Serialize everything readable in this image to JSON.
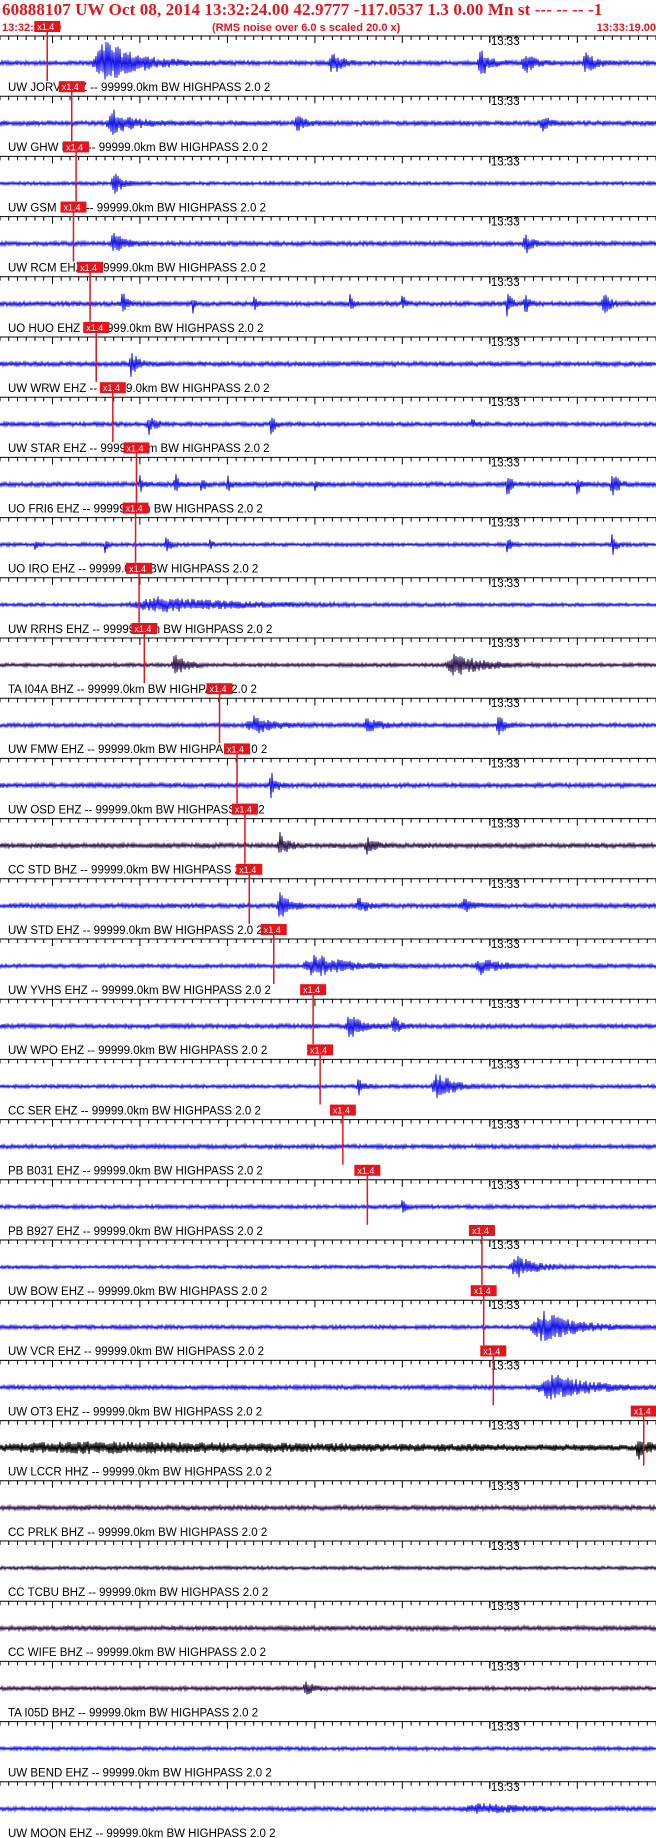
{
  "header": {
    "title": "60888107 UW Oct 08, 2014 13:32:24.00   42.9777 -117.0537  1.3 0.00 Mn st --- -- --  -1",
    "start_time": "13:32:04.00",
    "note": "(RMS noise over 6.0 s scaled 20.0 x)",
    "end_time": "13:33:19.00"
  },
  "colors": {
    "header_text": "#e8141c",
    "trace_blue": "#1414e6",
    "trace_dark": "#2a1450",
    "trace_black": "#000000",
    "pick": "#e8141c"
  },
  "chart_data": {
    "type": "seismogram",
    "x_start": "13:32:04.00",
    "x_end": "13:33:19.00",
    "minute_label": "13:33",
    "pick_label": "x1.4",
    "traces": [
      {
        "label": "UW JORV EHZ -- 99999.0km BW  HIGHPASS  2.0  2",
        "color": "blue",
        "pick": "13:32:09.40",
        "bursts": [
          {
            "t": 12,
            "w": 5,
            "a": 1.6
          },
          {
            "t": 38,
            "w": 1.5,
            "a": 0.8
          },
          {
            "t": 55,
            "w": 1.5,
            "a": 1.0
          },
          {
            "t": 60,
            "w": 1.5,
            "a": 0.8
          },
          {
            "t": 67,
            "w": 1.5,
            "a": 0.7
          }
        ]
      },
      {
        "label": "UW GHW EHZ -- 99999.0km BW  HIGHPASS  2.0  2",
        "color": "blue",
        "pick": "13:32:12.20",
        "bursts": [
          {
            "t": 13,
            "w": 3,
            "a": 0.9
          },
          {
            "t": 34,
            "w": 1.2,
            "a": 0.6
          },
          {
            "t": 62,
            "w": 1.2,
            "a": 0.5
          }
        ]
      },
      {
        "label": "UW GSM EHZ -- 99999.0km BW  HIGHPASS  2.0  2",
        "color": "blue",
        "pick": "13:32:12.70",
        "bursts": [
          {
            "t": 13,
            "w": 1.2,
            "a": 0.9
          }
        ]
      },
      {
        "label": "UW RCM EHZ -- 99999.0km BW  HIGHPASS  2.0  2",
        "color": "blue",
        "pick": "13:32:12.40",
        "bursts": [
          {
            "t": 13,
            "w": 1.5,
            "a": 0.8
          },
          {
            "t": 60,
            "w": 1.0,
            "a": 0.8
          }
        ]
      },
      {
        "label": "UO HUO EHZ -- 99999.0km BW  HIGHPASS  2.0  2",
        "color": "blue",
        "pick": "13:32:14.30",
        "bursts": [
          {
            "t": 14,
            "w": 0.6,
            "a": 0.9
          },
          {
            "t": 22,
            "w": 0.4,
            "a": 0.7
          },
          {
            "t": 29,
            "w": 0.4,
            "a": 0.6
          },
          {
            "t": 40,
            "w": 0.4,
            "a": 0.7
          },
          {
            "t": 46,
            "w": 0.4,
            "a": 0.7
          },
          {
            "t": 58,
            "w": 0.6,
            "a": 1.0
          },
          {
            "t": 60,
            "w": 0.6,
            "a": 0.9
          },
          {
            "t": 69,
            "w": 0.8,
            "a": 1.2
          }
        ]
      },
      {
        "label": "UW WRW EHZ -- 99999.0km BW  HIGHPASS  2.0  2",
        "color": "blue",
        "pick": "13:32:15.00",
        "bursts": [
          {
            "t": 15,
            "w": 1.2,
            "a": 0.8
          }
        ]
      },
      {
        "label": "UW STAR EHZ -- 99999.0km BW  HIGHPASS  2.0  2",
        "color": "blue",
        "pick": "13:32:16.90",
        "bursts": [
          {
            "t": 17,
            "w": 1.0,
            "a": 0.7
          },
          {
            "t": 31,
            "w": 0.6,
            "a": 0.8
          },
          {
            "t": 54,
            "w": 0.5,
            "a": 0.4
          }
        ]
      },
      {
        "label": "UO FRI6 EHZ -- 99999.0km BW  HIGHPASS  2.0  2",
        "color": "blue",
        "pick": "13:32:19.60",
        "bursts": [
          {
            "t": 16,
            "w": 0.5,
            "a": 0.6
          },
          {
            "t": 20,
            "w": 0.6,
            "a": 0.8
          },
          {
            "t": 23,
            "w": 0.5,
            "a": 0.7
          },
          {
            "t": 26,
            "w": 0.5,
            "a": 0.6
          },
          {
            "t": 36,
            "w": 0.4,
            "a": 0.5
          },
          {
            "t": 58,
            "w": 0.6,
            "a": 0.9
          },
          {
            "t": 66,
            "w": 0.5,
            "a": 0.8
          },
          {
            "t": 70,
            "w": 0.8,
            "a": 1.1
          }
        ]
      },
      {
        "label": "UO IRO EHZ -- 99999.0km BW  HIGHPASS  2.0  2",
        "color": "blue",
        "pick": "13:32:19.50",
        "bursts": [
          {
            "t": 4,
            "w": 0.4,
            "a": 0.6
          },
          {
            "t": 12,
            "w": 0.4,
            "a": 0.5
          },
          {
            "t": 19,
            "w": 0.6,
            "a": 0.7
          },
          {
            "t": 24,
            "w": 0.4,
            "a": 0.5
          },
          {
            "t": 58,
            "w": 0.5,
            "a": 0.8
          },
          {
            "t": 70,
            "w": 0.6,
            "a": 0.9
          }
        ]
      },
      {
        "label": "UW RRHS EHZ -- 99999.0km BW  HIGHPASS  2.0  2",
        "color": "blue",
        "pick": "13:32:19.90",
        "bursts": [
          {
            "t": 18,
            "w": 12,
            "a": 0.5
          }
        ]
      },
      {
        "label": "TA I04A BHZ -- 99999.0km BW  HIGHPASS  2.0  2",
        "color": "dark",
        "pick": "13:32:20.50",
        "bursts": [
          {
            "t": 20,
            "w": 1.5,
            "a": 1.0
          },
          {
            "t": 52,
            "w": 4,
            "a": 0.8
          }
        ]
      },
      {
        "label": "UW FMW EHZ -- 99999.0km BW  HIGHPASS  2.0  2",
        "color": "blue",
        "pick": "13:32:29.10",
        "bursts": [
          {
            "t": 29,
            "w": 3,
            "a": 0.6
          },
          {
            "t": 42,
            "w": 2,
            "a": 0.5
          },
          {
            "t": 57,
            "w": 1,
            "a": 0.7
          }
        ]
      },
      {
        "label": "UW OSD EHZ -- 99999.0km BW  HIGHPASS  2.0  2",
        "color": "blue",
        "pick": "13:32:31.10",
        "bursts": [
          {
            "t": 31,
            "w": 0.8,
            "a": 0.9
          }
        ]
      },
      {
        "label": "CC STD BHZ -- 99999.0km BW  HIGHPASS  2.0  2",
        "color": "dark",
        "pick": "13:32:32.00",
        "bursts": [
          {
            "t": 32,
            "w": 1.2,
            "a": 0.8
          },
          {
            "t": 42,
            "w": 1.2,
            "a": 0.6
          }
        ]
      },
      {
        "label": "UW STD EHZ -- 99999.0km BW  HIGHPASS  2.0  2",
        "color": "blue",
        "pick": "13:32:32.50",
        "bursts": [
          {
            "t": 32,
            "w": 1.5,
            "a": 0.9
          },
          {
            "t": 41,
            "w": 1.5,
            "a": 0.5
          },
          {
            "t": 53,
            "w": 1.5,
            "a": 0.5
          }
        ]
      },
      {
        "label": "UW YVHS EHZ -- 99999.0km BW  HIGHPASS  2.0  2",
        "color": "blue",
        "pick": "13:32:35.30",
        "bursts": [
          {
            "t": 36,
            "w": 5,
            "a": 0.8
          },
          {
            "t": 55,
            "w": 3,
            "a": 0.5
          }
        ]
      },
      {
        "label": "UW WPO EHZ -- 99999.0km BW  HIGHPASS  2.0  2",
        "color": "blue",
        "pick": "13:32:39.80",
        "bursts": [
          {
            "t": 40,
            "w": 2,
            "a": 0.8
          },
          {
            "t": 45,
            "w": 1,
            "a": 0.6
          }
        ]
      },
      {
        "label": "CC SER EHZ -- 99999.0km BW  HIGHPASS  2.0  2",
        "color": "blue",
        "pick": "13:32:40.60",
        "bursts": [
          {
            "t": 41,
            "w": 0.8,
            "a": 0.6
          },
          {
            "t": 50,
            "w": 2.5,
            "a": 1.0
          }
        ]
      },
      {
        "label": "PB B031 EHZ -- 99999.0km BW  HIGHPASS  2.0  2",
        "color": "blue",
        "pick": "13:32:43.20",
        "bursts": []
      },
      {
        "label": "PB B927 EHZ -- 99999.0km BW  HIGHPASS  2.0  2",
        "color": "blue",
        "pick": "13:32:46.00",
        "bursts": [
          {
            "t": 46,
            "w": 0.6,
            "a": 0.5
          }
        ]
      },
      {
        "label": "UW BOW EHZ -- 99999.0km BW  HIGHPASS  2.0  2",
        "color": "blue",
        "pick": "13:32:59.10",
        "bursts": [
          {
            "t": 59,
            "w": 3,
            "a": 0.8
          }
        ]
      },
      {
        "label": "UW VCR EHZ -- 99999.0km BW  HIGHPASS  2.0  2",
        "color": "blue",
        "pick": "13:32:59.30",
        "bursts": [
          {
            "t": 62,
            "w": 5,
            "a": 1.1
          }
        ]
      },
      {
        "label": "UW OT3 EHZ -- 99999.0km BW  HIGHPASS  2.0  2",
        "color": "blue",
        "pick": "13:33:00.40",
        "bursts": [
          {
            "t": 63,
            "w": 6,
            "a": 0.9
          }
        ]
      },
      {
        "label": "UW LCCR HHZ -- 99999.0km BW  HIGHPASS  2.0  2",
        "color": "black",
        "pick": "13:33:17.60",
        "bursts": [
          {
            "t": 10,
            "w": 70,
            "a": 0.35
          },
          {
            "t": 73,
            "w": 1.5,
            "a": 0.7
          }
        ]
      },
      {
        "label": "CC PRLK BHZ -- 99999.0km BW  HIGHPASS  2.0  2",
        "color": "dark",
        "pick": "",
        "bursts": []
      },
      {
        "label": "CC TCBU BHZ -- 99999.0km BW  HIGHPASS  2.0  2",
        "color": "dark",
        "pick": "",
        "bursts": []
      },
      {
        "label": "CC WIFE BHZ -- 99999.0km BW  HIGHPASS  2.0  2",
        "color": "dark",
        "pick": "",
        "bursts": []
      },
      {
        "label": "TA I05D BHZ -- 99999.0km BW  HIGHPASS  2.0  2",
        "color": "dark",
        "pick": "",
        "bursts": [
          {
            "t": 35,
            "w": 1.2,
            "a": 0.5
          }
        ]
      },
      {
        "label": "UW BEND EHZ -- 99999.0km BW  HIGHPASS  2.0  2",
        "color": "blue",
        "pick": "",
        "bursts": []
      },
      {
        "label": "UW MOON EHZ -- 99999.0km BW  HIGHPASS  2.0  2",
        "color": "blue",
        "pick": "",
        "bursts": [
          {
            "t": 55,
            "w": 8,
            "a": 0.3
          }
        ]
      }
    ]
  }
}
